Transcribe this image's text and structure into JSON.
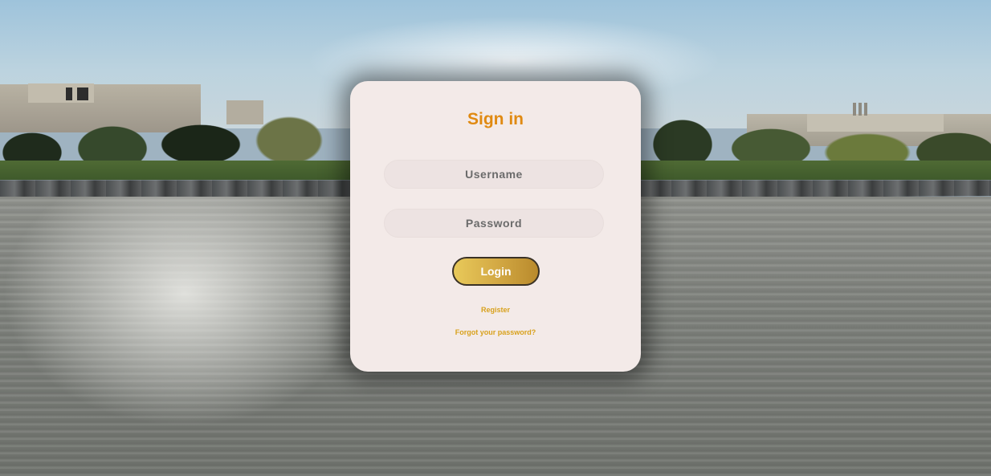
{
  "login": {
    "title": "Sign in",
    "username_placeholder": "Username",
    "password_placeholder": "Password",
    "login_label": "Login",
    "register_label": "Register",
    "forgot_label": "Forgot your password?"
  },
  "colors": {
    "title": "#e08a12",
    "link": "#d8a11c",
    "card_background": "#f3eae8",
    "button_gradient_start": "#e8c95a",
    "button_gradient_end": "#b98a2c"
  }
}
